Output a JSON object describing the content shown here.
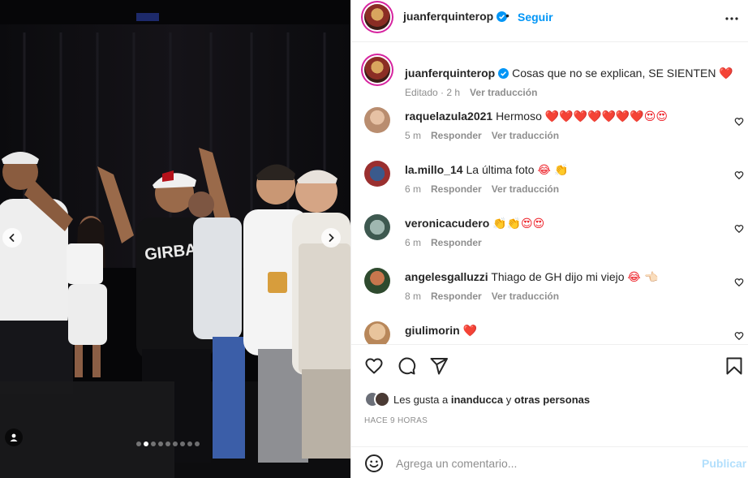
{
  "post": {
    "author": "juanferquinterop",
    "follow_label": "Seguir",
    "separator": "•",
    "caption_text": "Cosas que no se explican, SE SIENTEN",
    "caption_emoji": "❤️",
    "caption_meta_time": "Editado · 2 h",
    "caption_translate": "Ver traducción"
  },
  "comments": [
    {
      "user": "raquelazula2021",
      "text": "Hermoso",
      "emoji": "❤️❤️❤️❤️❤️❤️❤️😍😍",
      "time": "5 m",
      "reply": "Responder",
      "translate": "Ver traducción"
    },
    {
      "user": "la.millo_14",
      "text": "La última foto",
      "emoji": "😂 👏",
      "time": "6 m",
      "reply": "Responder",
      "translate": "Ver traducción"
    },
    {
      "user": "veronicacudero",
      "text": "",
      "emoji": "👏👏😍😍",
      "time": "6 m",
      "reply": "Responder",
      "translate": ""
    },
    {
      "user": "angelesgalluzzi",
      "text": "Thiago de GH dijo mi viejo",
      "emoji": "😂 👈🏻",
      "time": "8 m",
      "reply": "Responder",
      "translate": "Ver traducción"
    },
    {
      "user": "giulimorin",
      "text": "",
      "emoji": "❤️",
      "time": "",
      "reply": "",
      "translate": ""
    }
  ],
  "likes": {
    "prefix": "Les gusta a",
    "user": "inanducca",
    "middle": "y",
    "others": "otras personas"
  },
  "time_ago": "HACE 9 HORAS",
  "comment_box": {
    "placeholder": "Agrega un comentario...",
    "publish_label": "Publicar"
  },
  "carousel": {
    "total_slides": 9,
    "active_slide": 2
  },
  "colors": {
    "accent": "#0095f6",
    "publish_disabled": "#b2dffc",
    "muted": "#8e8e8e",
    "heart_red": "#ed1c24"
  },
  "icons": [
    "chevron-left-icon",
    "chevron-right-icon",
    "user-tag-icon",
    "verified-badge-icon",
    "more-options-icon",
    "heart-icon",
    "comment-icon",
    "share-icon",
    "bookmark-icon",
    "emoji-icon"
  ]
}
